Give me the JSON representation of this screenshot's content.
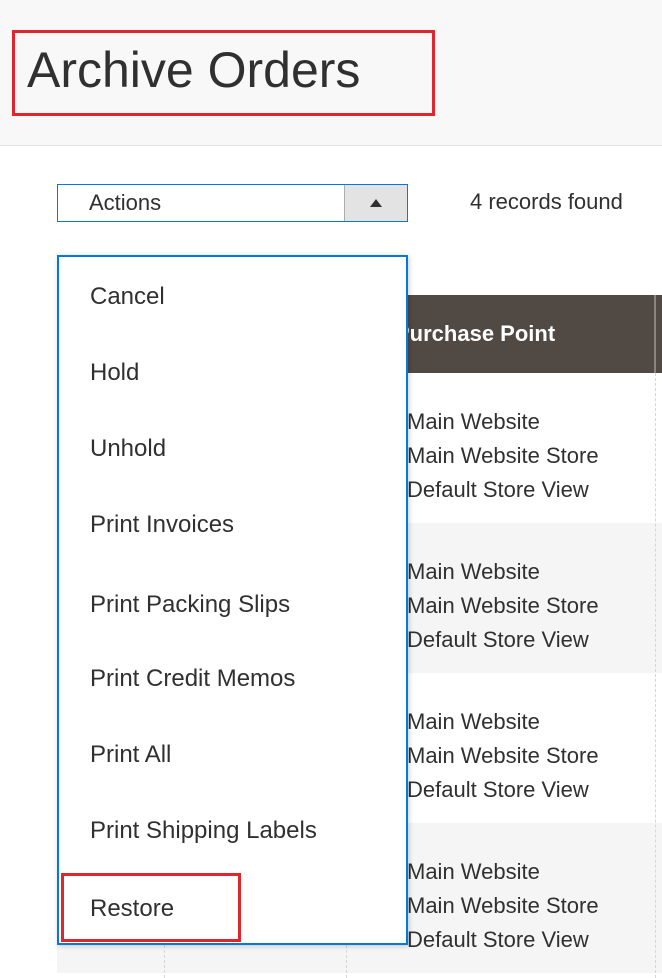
{
  "page": {
    "title": "Archive Orders"
  },
  "toolbar": {
    "actions_label": "Actions",
    "records_found": "4 records found"
  },
  "grid": {
    "header": {
      "purchase_point": "Purchase Point"
    },
    "rows": [
      {
        "website": "Main Website",
        "store": "Main Website Store",
        "view": "Default Store View"
      },
      {
        "website": "Main Website",
        "store": "Main Website Store",
        "view": "Default Store View"
      },
      {
        "website": "Main Website",
        "store": "Main Website Store",
        "view": "Default Store View"
      },
      {
        "website": "Main Website",
        "store": "Main Website Store",
        "view": "Default Store View"
      }
    ]
  },
  "actions_menu": {
    "items": [
      {
        "label": "Cancel"
      },
      {
        "label": "Hold"
      },
      {
        "label": "Unhold"
      },
      {
        "label": "Print Invoices"
      },
      {
        "label": "Print Packing Slips"
      },
      {
        "label": "Print Credit Memos"
      },
      {
        "label": "Print All"
      },
      {
        "label": "Print Shipping Labels"
      },
      {
        "label": "Restore"
      }
    ],
    "highlighted": "Restore"
  },
  "colors": {
    "accent": "#007bdb",
    "highlight": "#e0262c",
    "grid_header": "#514943"
  }
}
